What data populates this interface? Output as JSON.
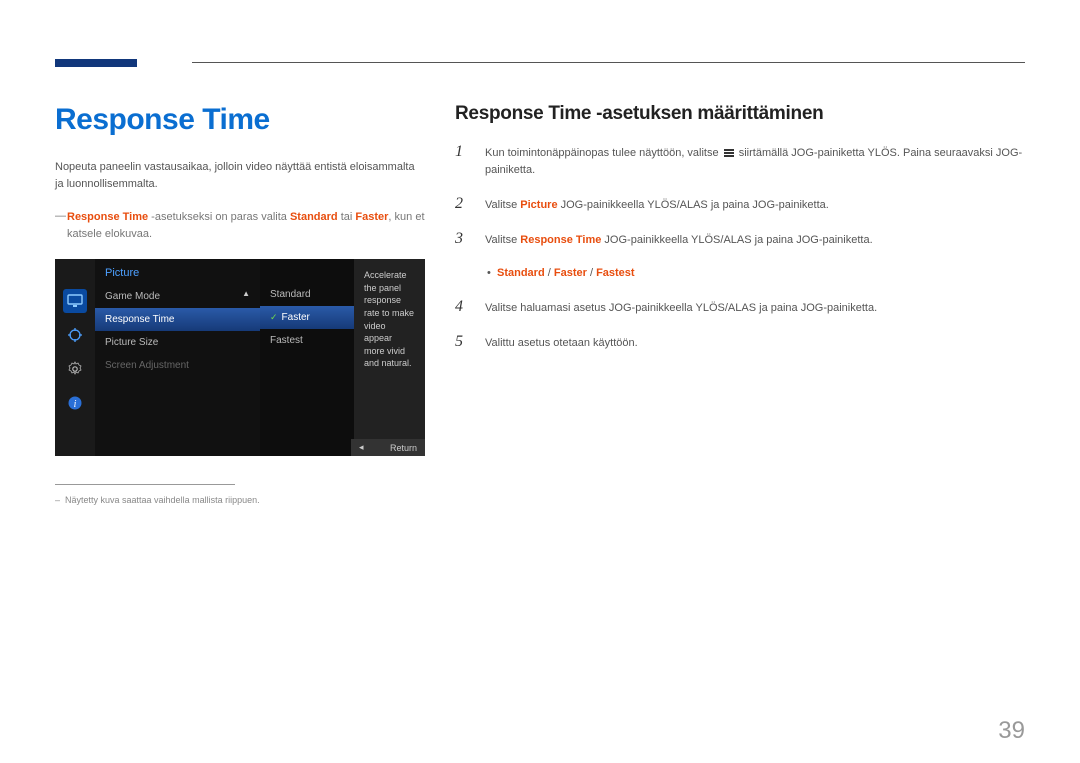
{
  "left": {
    "title": "Response Time",
    "intro": "Nopeuta paneelin vastausaikaa, jolloin video näyttää entistä eloisammalta ja luonnollisemmalta.",
    "note_hl": "Response Time",
    "note_mid": " -asetukseksi on paras valita ",
    "note_std": "Standard",
    "note_or": " tai ",
    "note_fast": "Faster",
    "note_tail": ", kun et katsele elokuvaa.",
    "footnote": "Näytetty kuva saattaa vaihdella mallista riippuen."
  },
  "osd": {
    "menu_title": "Picture",
    "items": [
      "Game Mode",
      "Response Time",
      "Picture Size",
      "Screen Adjustment"
    ],
    "sub": [
      "Standard",
      "Faster",
      "Fastest"
    ],
    "desc": "Accelerate the panel response rate to make video appear more vivid and natural.",
    "return": "Return"
  },
  "right": {
    "title": "Response Time -asetuksen määrittäminen",
    "step1a": "Kun toimintonäppäinopas tulee näyttöön, valitse ",
    "step1b": " siirtämällä JOG-painiketta YLÖS. Paina seuraavaksi JOG-painiketta.",
    "step2a": "Valitse ",
    "step2_hl": "Picture",
    "step2b": " JOG-painikkeella YLÖS/ALAS ja paina JOG-painiketta.",
    "step3a": "Valitse ",
    "step3_hl": "Response Time",
    "step3b": " JOG-painikkeella YLÖS/ALAS ja paina JOG-painiketta.",
    "opt_std": "Standard",
    "opt_sep": " / ",
    "opt_faster": "Faster",
    "opt_fastest": "Fastest",
    "step4": "Valitse haluamasi asetus JOG-painikkeella YLÖS/ALAS ja paina JOG-painiketta.",
    "step5": "Valittu asetus otetaan käyttöön."
  },
  "page_number": "39"
}
